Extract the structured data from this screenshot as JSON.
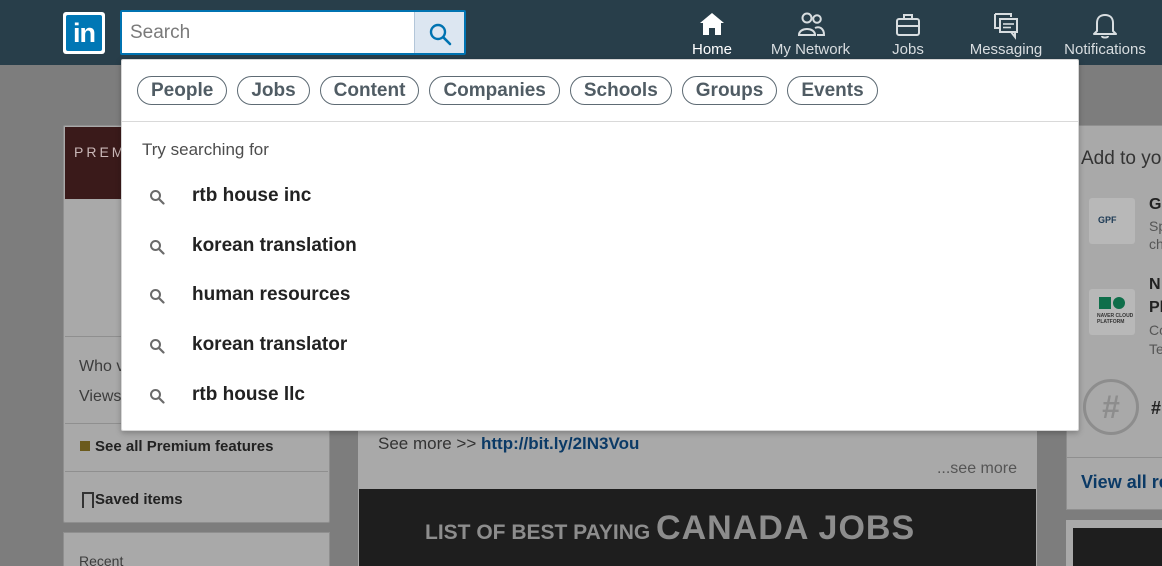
{
  "logo": {
    "text": "in"
  },
  "search": {
    "placeholder": "Search"
  },
  "nav": [
    {
      "label": "Home",
      "icon": "home-icon"
    },
    {
      "label": "My Network",
      "icon": "network-icon"
    },
    {
      "label": "Jobs",
      "icon": "briefcase-icon"
    },
    {
      "label": "Messaging",
      "icon": "messaging-icon"
    },
    {
      "label": "Notifications",
      "icon": "bell-icon"
    }
  ],
  "dropdown": {
    "filters": [
      "People",
      "Jobs",
      "Content",
      "Companies",
      "Schools",
      "Groups",
      "Events"
    ],
    "heading": "Try searching for",
    "suggestions": [
      "rtb house inc",
      "korean translation",
      "human resources",
      "korean translator",
      "rtb house llc"
    ]
  },
  "left": {
    "premium_banner": "PREM",
    "who_viewed": "Who v",
    "views": "Views",
    "premium_features": "See all Premium features",
    "saved_items": "Saved items",
    "recent": "Recent"
  },
  "feed": {
    "see_more_prefix": "See more >>",
    "link": "http://bit.ly/2lN3Vou",
    "see_more": "...see more",
    "banner_small": "LIST OF BEST PAYING",
    "banner_big": "CANADA JOBS"
  },
  "right": {
    "title": "Add to yo",
    "item1_logo": "GPF",
    "item1_name": "G",
    "item1_sub1": "Sp",
    "item1_sub2": "ch",
    "item2_logo_text": "NAVER CLOUD PLATFORM",
    "item2_name1": "N",
    "item2_name2": "Pl",
    "item2_sub1": "Co",
    "item2_sub2": "Te",
    "hashtag_icon": "#",
    "hashtag": "#l",
    "view_all": "View all re"
  },
  "colors": {
    "nav_bg": "#283e4a",
    "linkedin_blue": "#0073b1",
    "overlay_bg": "#7d7d7d"
  }
}
